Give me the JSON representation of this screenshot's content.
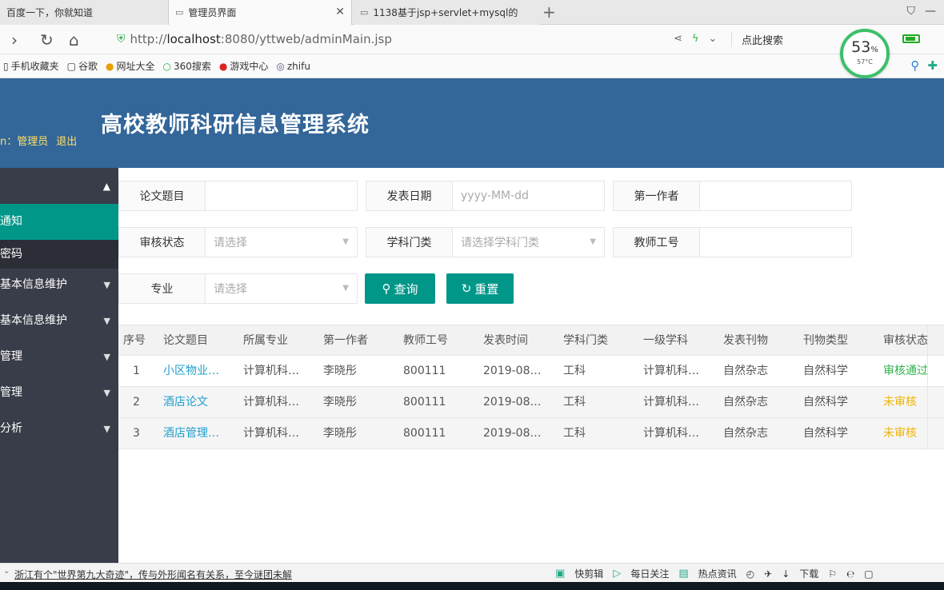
{
  "browser": {
    "tabs": [
      {
        "title": "百度一下，你就知道",
        "active": false
      },
      {
        "title": "管理员界面",
        "active": true
      },
      {
        "title": "1138基于jsp+servlet+mysql的",
        "active": false
      }
    ],
    "url_prefix": "http://",
    "url_host": "localhost",
    "url_rest": ":8080/yttweb/adminMain.jsp",
    "search_label": "点此搜索",
    "bookmarks": [
      "手机收藏夹",
      "谷歌",
      "网址大全",
      "360搜索",
      "游戏中心",
      "zhifu"
    ],
    "gauge_pct": "53",
    "gauge_unit": "%",
    "gauge_temp": "57°C"
  },
  "header": {
    "user_text": "n：管理员",
    "logout": "退出",
    "title": "高校教师科研信息管理系统"
  },
  "sidebar": {
    "items": [
      {
        "label": "通知",
        "active": true
      },
      {
        "label": "密码",
        "sub": true
      },
      {
        "label": "基本信息维护"
      },
      {
        "label": "基本信息维护"
      },
      {
        "label": "管理"
      },
      {
        "label": "管理"
      },
      {
        "label": "分析"
      }
    ]
  },
  "filters": {
    "title_label": "论文题目",
    "date_label": "发表日期",
    "date_placeholder": "yyyy-MM-dd",
    "author_label": "第一作者",
    "status_label": "审核状态",
    "status_placeholder": "请选择",
    "category_label": "学科门类",
    "category_placeholder": "请选择学科门类",
    "teacher_id_label": "教师工号",
    "major_label": "专业",
    "major_placeholder": "请选择",
    "search_button": "查询",
    "reset_button": "重置"
  },
  "table": {
    "columns": [
      "序号",
      "论文题目",
      "所属专业",
      "第一作者",
      "教师工号",
      "发表时间",
      "学科门类",
      "一级学科",
      "发表刊物",
      "刊物类型",
      "审核状态"
    ],
    "rows": [
      [
        "1",
        "小区物业…",
        "计算机科…",
        "李晓彤",
        "800111",
        "2019-08…",
        "工科",
        "计算机科…",
        "自然杂志",
        "自然科学",
        "审核通过"
      ],
      [
        "2",
        "酒店论文",
        "计算机科…",
        "李晓彤",
        "800111",
        "2019-08…",
        "工科",
        "计算机科…",
        "自然杂志",
        "自然科学",
        "未审核"
      ],
      [
        "3",
        "酒店管理…",
        "计算机科…",
        "李晓彤",
        "800111",
        "2019-08…",
        "工科",
        "计算机科…",
        "自然杂志",
        "自然科学",
        "未审核"
      ]
    ]
  },
  "statusbar": {
    "news": "浙江有个\"世界第九大奇迹\"，传与外形闻名有关系，至今谜团未解",
    "tools": [
      "快剪辑",
      "每日关注",
      "热点资讯",
      "下载"
    ]
  }
}
